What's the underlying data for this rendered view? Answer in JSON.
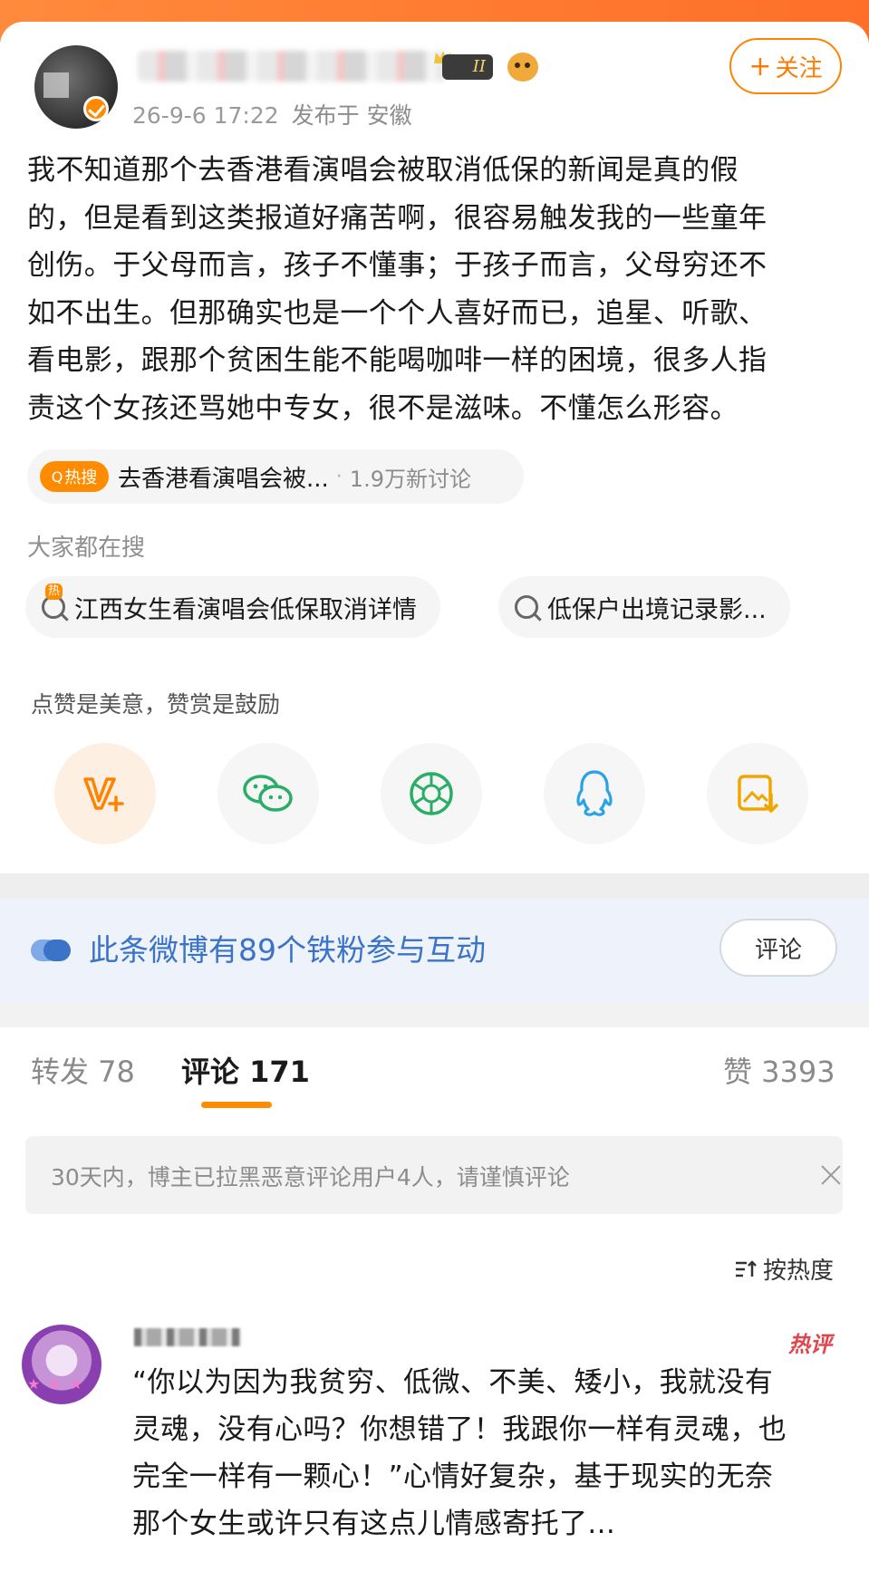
{
  "post": {
    "meta_date": "26-9-6 17:22",
    "meta_location": "发布于 安徽",
    "vip_level": "II",
    "follow_plus": "+",
    "follow_label": "关注",
    "text_lines": [
      "我不知道那个去香港看演唱会被取消低保的新闻是真的假",
      "的，但是看到这类报道好痛苦啊，很容易触发我的一些童年",
      "创伤。于父母而言，孩子不懂事；于孩子而言，父母穷还不",
      "如不出生。但那确实也是一个个人喜好而已，追星、听歌、",
      "看电影，跟那个贫困生能不能喝咖啡一样的困境，很多人指",
      "责这个女孩还骂她中专女，很不是滋味。不懂怎么形容。"
    ]
  },
  "hot_topic": {
    "badge": "热搜",
    "badge_icon": "Q",
    "topic": "去香港看演唱会被...",
    "separator": "·",
    "count": "1.9万新讨论"
  },
  "searches": {
    "label": "大家都在搜",
    "items": [
      {
        "text": "江西女生看演唱会低保取消详情",
        "hot": "热"
      },
      {
        "text": "低保户出境记录影..."
      }
    ]
  },
  "share": {
    "tip": "点赞是美意，赞赏是鼓励",
    "items": [
      {
        "icon": "reward-v-icon",
        "color": "#ff8200"
      },
      {
        "icon": "wechat-icon",
        "color": "#2aae67"
      },
      {
        "icon": "moments-icon",
        "color": "#2aae67"
      },
      {
        "icon": "qq-icon",
        "color": "#2aa2e6"
      },
      {
        "icon": "save-image-icon",
        "color": "#f0a500"
      }
    ]
  },
  "fans": {
    "text": "此条微博有89个铁粉参与互动",
    "button": "评论"
  },
  "tabs": {
    "repost": "转发 78",
    "comment": "评论 171",
    "like": "赞 3393"
  },
  "notice": {
    "text": "30天内，博主已拉黑恶意评论用户4人，请谨慎评论"
  },
  "sort": {
    "label": "按热度"
  },
  "comment": {
    "hot_tag": "热评",
    "text_lines": [
      "“你以为因为我贫穷、低微、不美、矮小，我就没有",
      "灵魂，没有心吗？你想错了！我跟你一样有灵魂，也",
      "完全一样有一颗心！”心情好复杂，基于现实的无奈",
      "那个女生或许只有这点儿情感寄托了..."
    ]
  },
  "colors": {
    "accent": "#ff8200",
    "link_blue": "#3a73c8",
    "hot_red": "#e0474d"
  }
}
